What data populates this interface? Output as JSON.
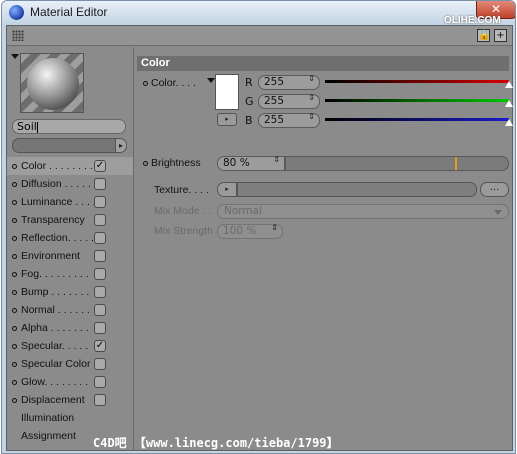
{
  "window": {
    "title": "Material Editor",
    "close_glyph": "✕",
    "watermark_top": "OLIHE.COM"
  },
  "toolbar": {
    "grip_icon": "grip-icon",
    "lock_icon": "lock-icon",
    "new_icon": "plus-icon",
    "lock_glyph": "🔒",
    "new_glyph": "+"
  },
  "material": {
    "name": "Soil",
    "preview_arrow_icon": "dropdown-arrow-icon",
    "dropdown_glyph": "▸"
  },
  "channels": [
    {
      "label": "Color . . . . . . . .",
      "checked": true,
      "has_dot": true,
      "active": true
    },
    {
      "label": "Diffusion . . . . .",
      "checked": false,
      "has_dot": true,
      "active": false
    },
    {
      "label": "Luminance . . . .",
      "checked": false,
      "has_dot": true,
      "active": false
    },
    {
      "label": "Transparency",
      "checked": false,
      "has_dot": true,
      "active": false
    },
    {
      "label": "Reflection. . . . .",
      "checked": false,
      "has_dot": true,
      "active": false
    },
    {
      "label": "Environment",
      "checked": false,
      "has_dot": true,
      "active": false
    },
    {
      "label": "Fog. . . . . . . . .",
      "checked": false,
      "has_dot": true,
      "active": false
    },
    {
      "label": "Bump . . . . . . .",
      "checked": false,
      "has_dot": true,
      "active": false
    },
    {
      "label": "Normal . . . . . .",
      "checked": false,
      "has_dot": true,
      "active": false
    },
    {
      "label": "Alpha . . . . . . .",
      "checked": false,
      "has_dot": true,
      "active": false
    },
    {
      "label": "Specular. . . . .",
      "checked": true,
      "has_dot": true,
      "active": false
    },
    {
      "label": "Specular Color",
      "checked": false,
      "has_dot": true,
      "active": false
    },
    {
      "label": "Glow. . . . . . . .",
      "checked": false,
      "has_dot": true,
      "active": false
    },
    {
      "label": "Displacement",
      "checked": false,
      "has_dot": true,
      "active": false
    },
    {
      "label": "Illumination",
      "checked": null,
      "has_dot": false,
      "active": false
    },
    {
      "label": "Assignment",
      "checked": null,
      "has_dot": false,
      "active": false
    }
  ],
  "checkmark_glyph": "✓",
  "color_section": {
    "header": "Color",
    "color_label": "Color. . . .",
    "r_label": "R",
    "g_label": "G",
    "b_label": "B",
    "r_value": "255",
    "g_value": "255",
    "b_value": "255",
    "r_fraction": 1.0,
    "g_fraction": 1.0,
    "b_fraction": 1.0,
    "r_color": "#d40000",
    "g_color": "#00c800",
    "b_color": "#1a1acc",
    "swatch_color": "#ffffff",
    "brightness_label": "Brightness",
    "brightness_value": "80 %",
    "brightness_marker_color": "#e0a020",
    "texture_label": "Texture. . . .",
    "texture_more": "...",
    "mix_mode_label": "Mix Mode . .",
    "mix_mode_value": "Normal",
    "mix_strength_label": "Mix Strength",
    "mix_strength_value": "100 %",
    "spin_glyph": "⇕",
    "play_glyph": "▸"
  },
  "watermark_bottom": "C4D吧 【www.linecg.com/tieba/1799】"
}
